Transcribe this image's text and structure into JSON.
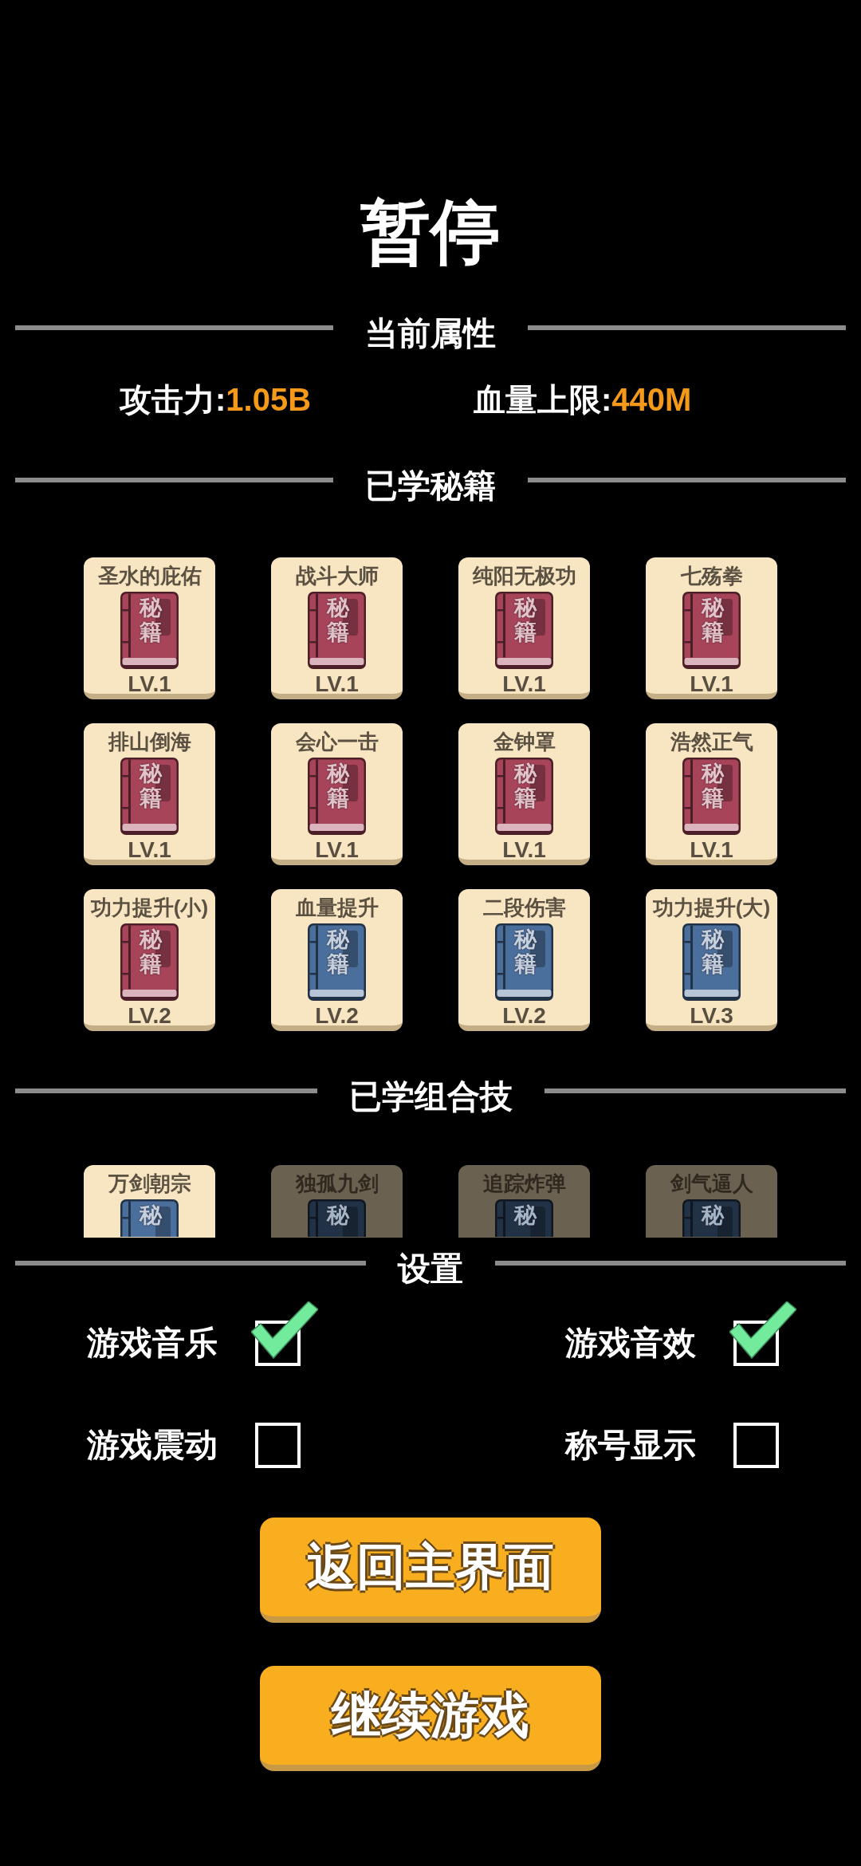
{
  "title": "暂停",
  "attributes": {
    "heading": "当前属性",
    "stats": [
      {
        "label": "攻击力:",
        "value": "1.05B"
      },
      {
        "label": "血量上限:",
        "value": "440M"
      }
    ]
  },
  "skills": {
    "heading": "已学秘籍",
    "items": [
      {
        "name": "圣水的庇佑",
        "cover": "秘籍",
        "level": "LV.1",
        "color": "#a8445a"
      },
      {
        "name": "战斗大师",
        "cover": "秘籍",
        "level": "LV.1",
        "color": "#a8445a"
      },
      {
        "name": "纯阳无极功",
        "cover": "秘籍",
        "level": "LV.1",
        "color": "#a8445a"
      },
      {
        "name": "七殇拳",
        "cover": "秘籍",
        "level": "LV.1",
        "color": "#a8445a"
      },
      {
        "name": "排山倒海",
        "cover": "秘籍",
        "level": "LV.1",
        "color": "#a8445a"
      },
      {
        "name": "会心一击",
        "cover": "秘籍",
        "level": "LV.1",
        "color": "#a8445a"
      },
      {
        "name": "金钟罩",
        "cover": "秘籍",
        "level": "LV.1",
        "color": "#a8445a"
      },
      {
        "name": "浩然正气",
        "cover": "秘籍",
        "level": "LV.1",
        "color": "#a8445a"
      },
      {
        "name": "功力提升(小)",
        "cover": "秘籍",
        "level": "LV.2",
        "color": "#a8445a"
      },
      {
        "name": "血量提升",
        "cover": "秘籍",
        "level": "LV.2",
        "color": "#4b6f9c"
      },
      {
        "name": "二段伤害",
        "cover": "秘籍",
        "level": "LV.2",
        "color": "#4b6f9c"
      },
      {
        "name": "功力提升(大)",
        "cover": "秘籍",
        "level": "LV.3",
        "color": "#4b6f9c"
      }
    ]
  },
  "combos": {
    "heading": "已学组合技",
    "items": [
      {
        "name": "万剑朝宗",
        "cover": "秘",
        "locked": false
      },
      {
        "name": "独孤九剑",
        "cover": "秘",
        "locked": true
      },
      {
        "name": "追踪炸弹",
        "cover": "秘",
        "locked": true
      },
      {
        "name": "剑气逼人",
        "cover": "秘",
        "locked": true
      }
    ]
  },
  "settings": {
    "heading": "设置",
    "options": [
      {
        "label": "游戏音乐",
        "checked": true
      },
      {
        "label": "游戏音效",
        "checked": true
      },
      {
        "label": "游戏震动",
        "checked": false
      },
      {
        "label": "称号显示",
        "checked": false
      }
    ]
  },
  "buttons": [
    {
      "label": "返回主界面"
    },
    {
      "label": "继续游戏"
    }
  ]
}
